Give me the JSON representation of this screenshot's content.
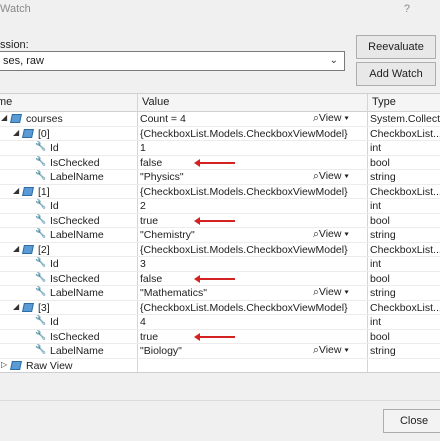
{
  "window": {
    "title": "Watch",
    "help": "?"
  },
  "expression": {
    "label": "ssion:",
    "value": "ses, raw"
  },
  "buttons": {
    "reevaluate": "Reevaluate",
    "add_watch": "Add Watch",
    "close": "Close"
  },
  "grid": {
    "headers": {
      "name": "me",
      "value": "Value",
      "type": "Type"
    },
    "view_label": "View",
    "rows": [
      {
        "name": "courses",
        "value": "Count = 4",
        "type": "System.Collect...",
        "view": true
      },
      {
        "name": "[0]",
        "value": "{CheckboxList.Models.CheckboxViewModel}",
        "type": "CheckboxList...."
      },
      {
        "name": "Id",
        "value": "1",
        "type": "int"
      },
      {
        "name": "IsChecked",
        "value": "false",
        "type": "bool",
        "arrow": true
      },
      {
        "name": "LabelName",
        "value": "\"Physics\"",
        "type": "string",
        "view": true
      },
      {
        "name": "[1]",
        "value": "{CheckboxList.Models.CheckboxViewModel}",
        "type": "CheckboxList...."
      },
      {
        "name": "Id",
        "value": "2",
        "type": "int"
      },
      {
        "name": "IsChecked",
        "value": "true",
        "type": "bool",
        "arrow": true
      },
      {
        "name": "LabelName",
        "value": "\"Chemistry\"",
        "type": "string",
        "view": true
      },
      {
        "name": "[2]",
        "value": "{CheckboxList.Models.CheckboxViewModel}",
        "type": "CheckboxList...."
      },
      {
        "name": "Id",
        "value": "3",
        "type": "int"
      },
      {
        "name": "IsChecked",
        "value": "false",
        "type": "bool",
        "arrow": true
      },
      {
        "name": "LabelName",
        "value": "\"Mathematics\"",
        "type": "string",
        "view": true
      },
      {
        "name": "[3]",
        "value": "{CheckboxList.Models.CheckboxViewModel}",
        "type": "CheckboxList...."
      },
      {
        "name": "Id",
        "value": "4",
        "type": "int"
      },
      {
        "name": "IsChecked",
        "value": "true",
        "type": "bool",
        "arrow": true
      },
      {
        "name": "LabelName",
        "value": "\"Biology\"",
        "type": "string",
        "view": true
      },
      {
        "name": "Raw View",
        "value": "",
        "type": ""
      }
    ]
  }
}
